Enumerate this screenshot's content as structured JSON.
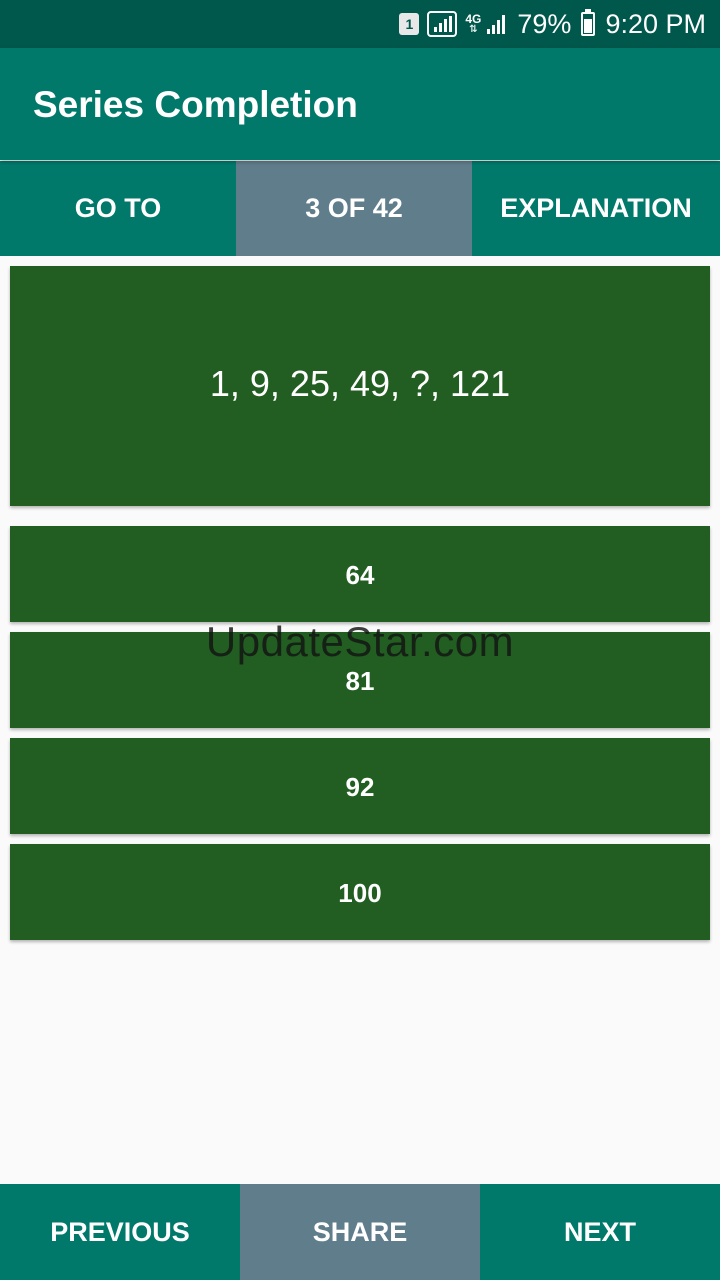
{
  "status_bar": {
    "sim_label": "1",
    "network_label": "4G",
    "battery_percent": "79%",
    "battery_level": 0.79,
    "time": "9:20 PM"
  },
  "app_bar": {
    "title": "Series Completion"
  },
  "top_tabs": {
    "goto_label": "GO TO",
    "progress_label": "3 OF 42",
    "explanation_label": "EXPLANATION"
  },
  "question": {
    "text": "1, 9, 25, 49, ?, 121"
  },
  "options": [
    "64",
    "81",
    "92",
    "100"
  ],
  "watermark": "UpdateStar.com",
  "bottom_bar": {
    "previous_label": "PREVIOUS",
    "share_label": "SHARE",
    "next_label": "NEXT"
  },
  "colors": {
    "status_bar_bg": "#00574B",
    "primary": "#00796B",
    "tab_selected": "#607D8B",
    "card_green": "#225E21",
    "background": "#FAFAFA",
    "text_on_dark": "#FFFFFF"
  }
}
